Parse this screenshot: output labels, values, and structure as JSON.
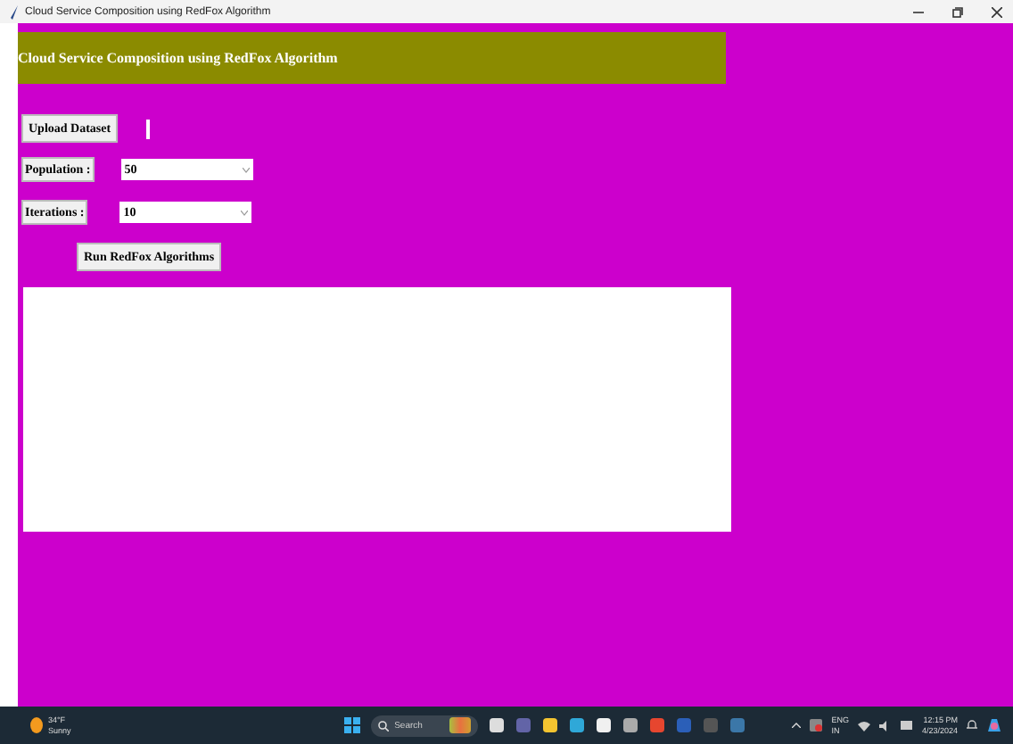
{
  "window": {
    "title": "Cloud Service Composition using RedFox Algorithm"
  },
  "header": {
    "title": "Cloud Service Composition using RedFox Algorithm"
  },
  "upload_button": "Upload Dataset",
  "fields": [
    {
      "label": "Population :",
      "value": "50"
    },
    {
      "label": "Iterations :",
      "value": "10"
    }
  ],
  "run_button": "Run RedFox Algorithms",
  "taskbar": {
    "weather": {
      "temperature": "34°F",
      "condition": "Sunny"
    },
    "search": {
      "placeholder": "Search"
    },
    "language": "ENG",
    "region": "IN",
    "time": "12:15 PM",
    "date": "4/23/2024"
  }
}
